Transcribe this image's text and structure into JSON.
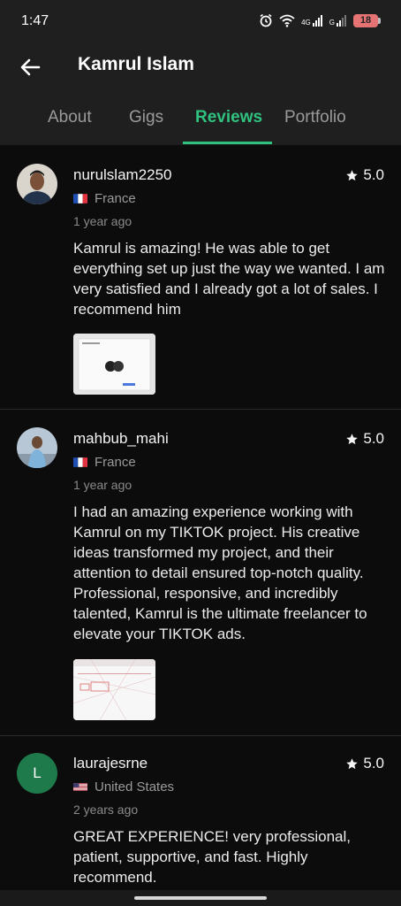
{
  "status": {
    "time": "1:47",
    "battery": "18",
    "network_label_1": "4G",
    "network_label_2": "G"
  },
  "header": {
    "title": "Kamrul Islam",
    "back_icon": "arrow-left-icon"
  },
  "tabs": [
    {
      "label": "About",
      "active": false
    },
    {
      "label": "Gigs",
      "active": false
    },
    {
      "label": "Reviews",
      "active": true
    },
    {
      "label": "Portfolio",
      "active": false
    }
  ],
  "colors": {
    "accent": "#2fc27f",
    "background": "#0c0c0c",
    "header_bg": "#1f1f1f",
    "avatar_letter_bg": "#1e7a4a"
  },
  "reviews": [
    {
      "username": "nurulslam2250",
      "rating": "5.0",
      "country": "France",
      "time_ago": "1 year ago",
      "text": "Kamrul is amazing! He was able to get everything set up just the way we wanted. I am very satisfied and I already got a lot of sales. I recommend him",
      "avatar_type": "photo",
      "has_attachment": true
    },
    {
      "username": "mahbub_mahi",
      "rating": "5.0",
      "country": "France",
      "time_ago": "1 year ago",
      "text": "I had an amazing experience working with Kamrul on my TIKTOK project. His creative ideas transformed my project, and their attention to detail ensured top-notch quality. Professional, responsive, and incredibly talented, Kamrul is the ultimate freelancer to elevate your TIKTOK ads.",
      "avatar_type": "photo",
      "has_attachment": true
    },
    {
      "username": "laurajesrne",
      "rating": "5.0",
      "country": "United States",
      "time_ago": "2 years ago",
      "text": "GREAT EXPERIENCE! very professional, patient, supportive, and fast. Highly recommend.",
      "avatar_type": "letter",
      "avatar_letter": "L",
      "has_attachment": false
    }
  ]
}
